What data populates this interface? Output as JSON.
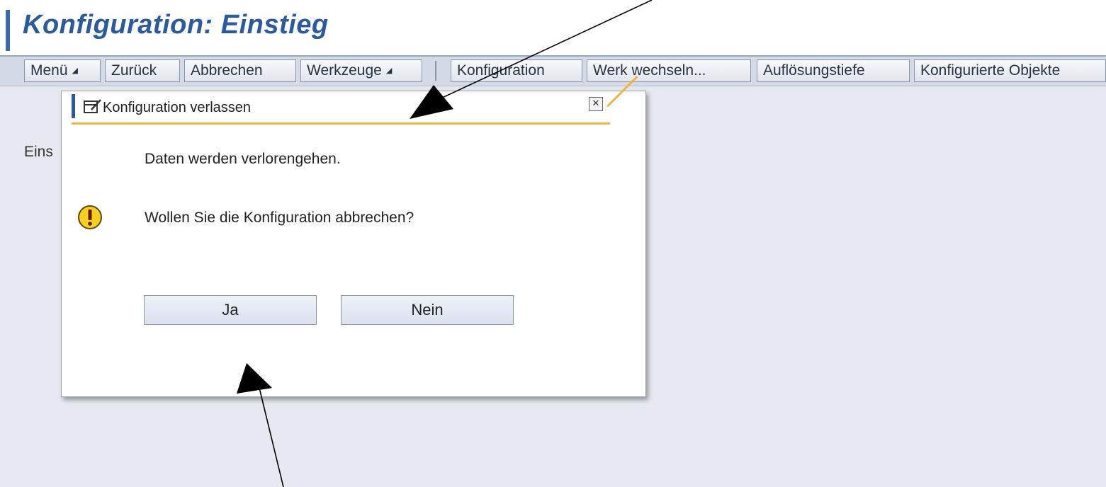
{
  "window": {
    "title": "Konfiguration: Einstieg"
  },
  "toolbar": {
    "items": [
      {
        "label": "Menü",
        "has_dropdown": true
      },
      {
        "label": "Zurück",
        "has_dropdown": false
      },
      {
        "label": "Abbrechen",
        "has_dropdown": false
      },
      {
        "label": "Werkzeuge",
        "has_dropdown": true
      },
      {
        "label": "Konfiguration",
        "has_dropdown": false
      },
      {
        "label": "Werk wechseln...",
        "has_dropdown": false
      },
      {
        "label": "Auflösungstiefe",
        "has_dropdown": false
      },
      {
        "label": "Konfigurierte Objekte",
        "has_dropdown": false
      }
    ]
  },
  "background": {
    "label_partial": "Eins"
  },
  "dialog": {
    "title": "Konfiguration verlassen",
    "title_icon": "edit-window-icon",
    "close_icon": "close-icon",
    "message_line1": "Daten werden verlorengehen.",
    "message_line2": "Wollen Sie die Konfiguration abbrechen?",
    "warning_icon": "warning-icon",
    "buttons": {
      "yes": "Ja",
      "no": "Nein"
    }
  },
  "colors": {
    "title_text": "#2c5a9b",
    "accent_orange": "#f2b346",
    "warning_yellow": "#f5d020",
    "page_background": "#e6e9f0",
    "toolbar_background": "#d5dbe6"
  }
}
